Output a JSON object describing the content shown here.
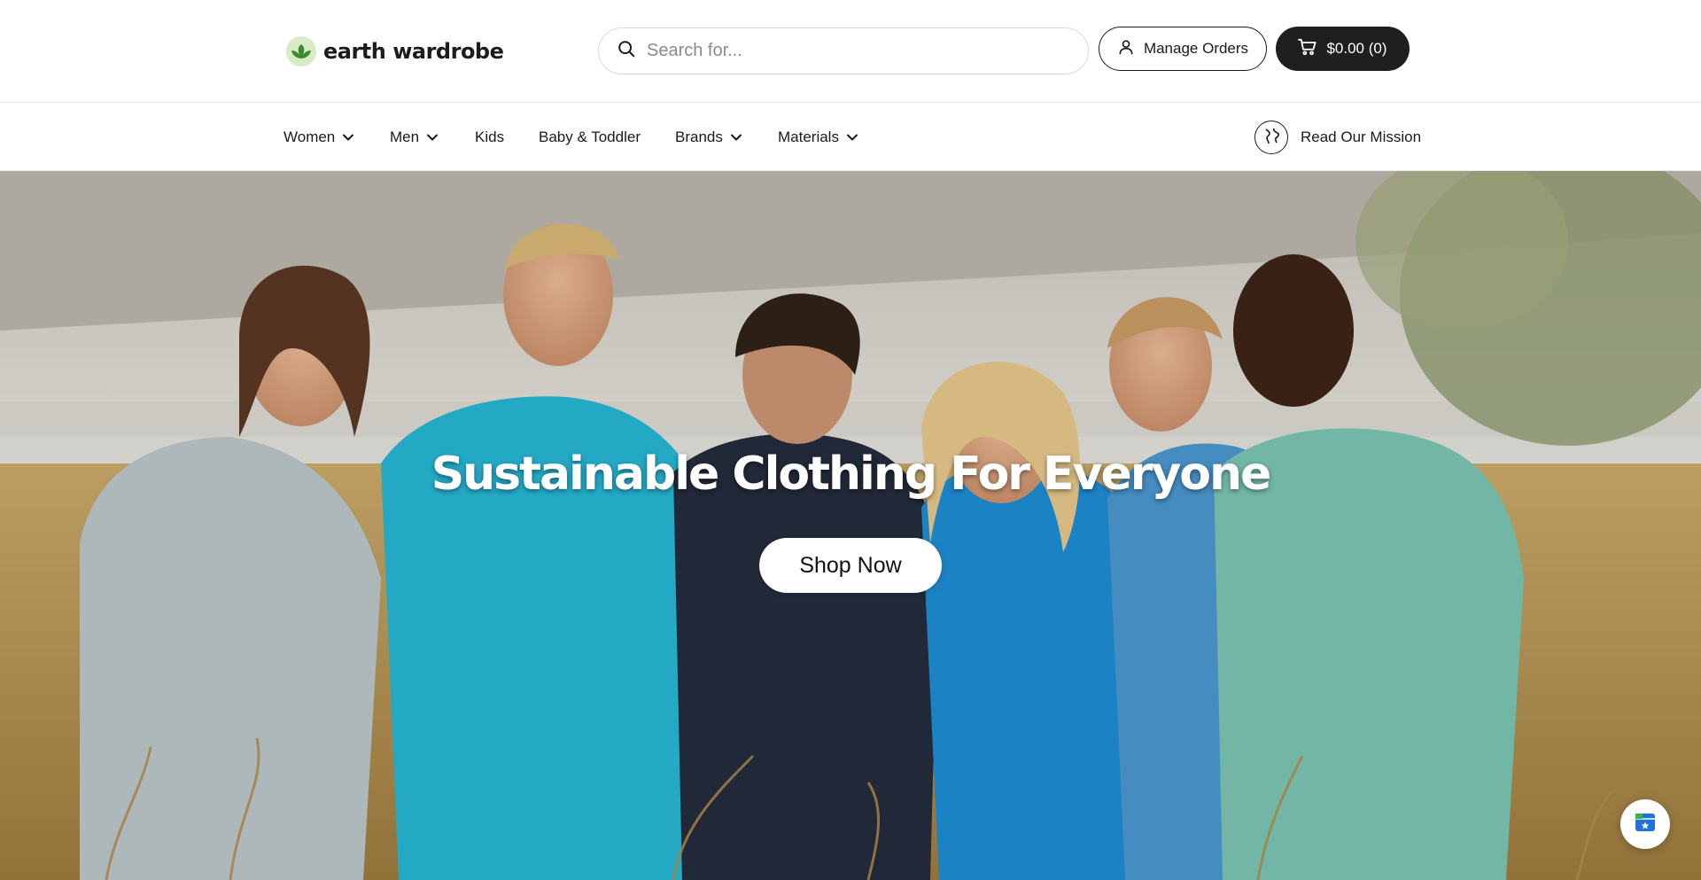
{
  "header": {
    "logo_text": "earth wardrobe",
    "search": {
      "placeholder": "Search for..."
    },
    "manage_orders_label": "Manage Orders",
    "cart_label": "$0.00 (0)"
  },
  "nav": {
    "items": [
      {
        "label": "Women",
        "has_dropdown": true
      },
      {
        "label": "Men",
        "has_dropdown": true
      },
      {
        "label": "Kids",
        "has_dropdown": false
      },
      {
        "label": "Baby & Toddler",
        "has_dropdown": false
      },
      {
        "label": "Brands",
        "has_dropdown": true
      },
      {
        "label": "Materials",
        "has_dropdown": true
      }
    ],
    "mission_label": "Read Our Mission"
  },
  "hero": {
    "title": "Sustainable Clothing For Everyone",
    "button_label": "Shop Now"
  },
  "colors": {
    "primary_dark": "#1f1f1f",
    "logo_green": "#3a8a2e",
    "hero_button_bg": "#ffffff"
  },
  "icons": {
    "search": "search-icon",
    "user": "user-icon",
    "cart": "cart-icon",
    "globe": "globe-icon",
    "chevron": "chevron-down-icon",
    "chat": "chat-widget-icon"
  }
}
